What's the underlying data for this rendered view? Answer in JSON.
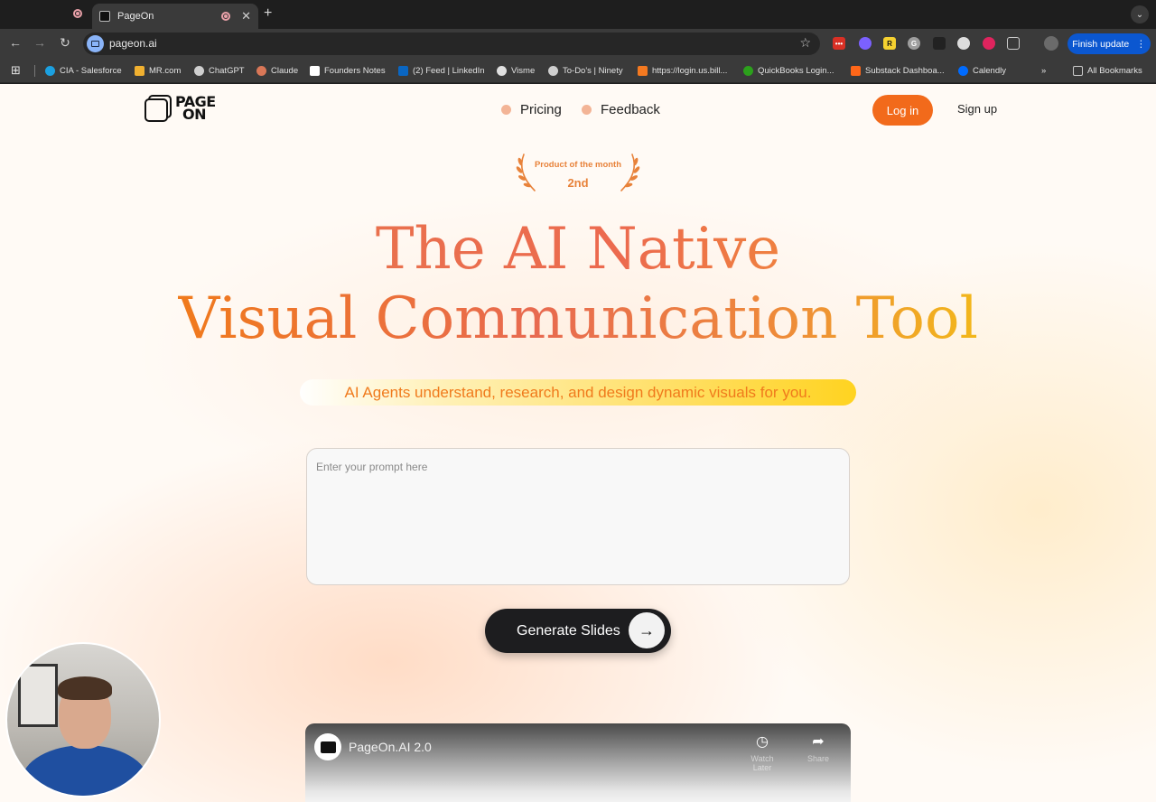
{
  "browser": {
    "tab_title": "PageOn",
    "url": "pageon.ai",
    "finish_update_label": "Finish update",
    "bookmarks": [
      {
        "label": "CIA - Salesforce",
        "color": "#1ba0e0"
      },
      {
        "label": "MR.com",
        "color": "#f0b030"
      },
      {
        "label": "ChatGPT",
        "color": "#cfcfcf"
      },
      {
        "label": "Claude",
        "color": "#d97757"
      },
      {
        "label": "Founders Notes",
        "color": "#ffffff"
      },
      {
        "label": "(2) Feed | LinkedIn",
        "color": "#0a66c2"
      },
      {
        "label": "Visme",
        "color": "#e0e0e0"
      },
      {
        "label": "To-Do's | Ninety",
        "color": "#cfcfcf"
      },
      {
        "label": "https://login.us.bill...",
        "color": "#f47920"
      },
      {
        "label": "QuickBooks Login...",
        "color": "#2ca01c"
      },
      {
        "label": "Substack Dashboa...",
        "color": "#ff6719"
      },
      {
        "label": "Calendly",
        "color": "#006bff"
      }
    ],
    "all_bookmarks_label": "All Bookmarks"
  },
  "nav": {
    "logo_line1": "PAGE",
    "logo_line2": "ON",
    "links": [
      "Pricing",
      "Feedback"
    ],
    "login_label": "Log in",
    "signup_label": "Sign up"
  },
  "award": {
    "line1": "Product of the month",
    "line2": "2nd"
  },
  "hero": {
    "line1": "The AI Native",
    "line2": "Visual Communication Tool",
    "tagline": "AI Agents understand, research, and design dynamic visuals for you."
  },
  "prompt": {
    "placeholder": "Enter your prompt here",
    "value": ""
  },
  "generate": {
    "label": "Generate Slides",
    "icon": "arrow-right-icon"
  },
  "video": {
    "title": "PageOn.AI 2.0",
    "watch_later_label": "Watch Later",
    "share_label": "Share"
  },
  "colors": {
    "accent": "#f26a1b",
    "tagline_highlight": "#ffd320",
    "hero_gradient_start": "#f07a1c",
    "hero_gradient_end": "#f2b71a"
  }
}
